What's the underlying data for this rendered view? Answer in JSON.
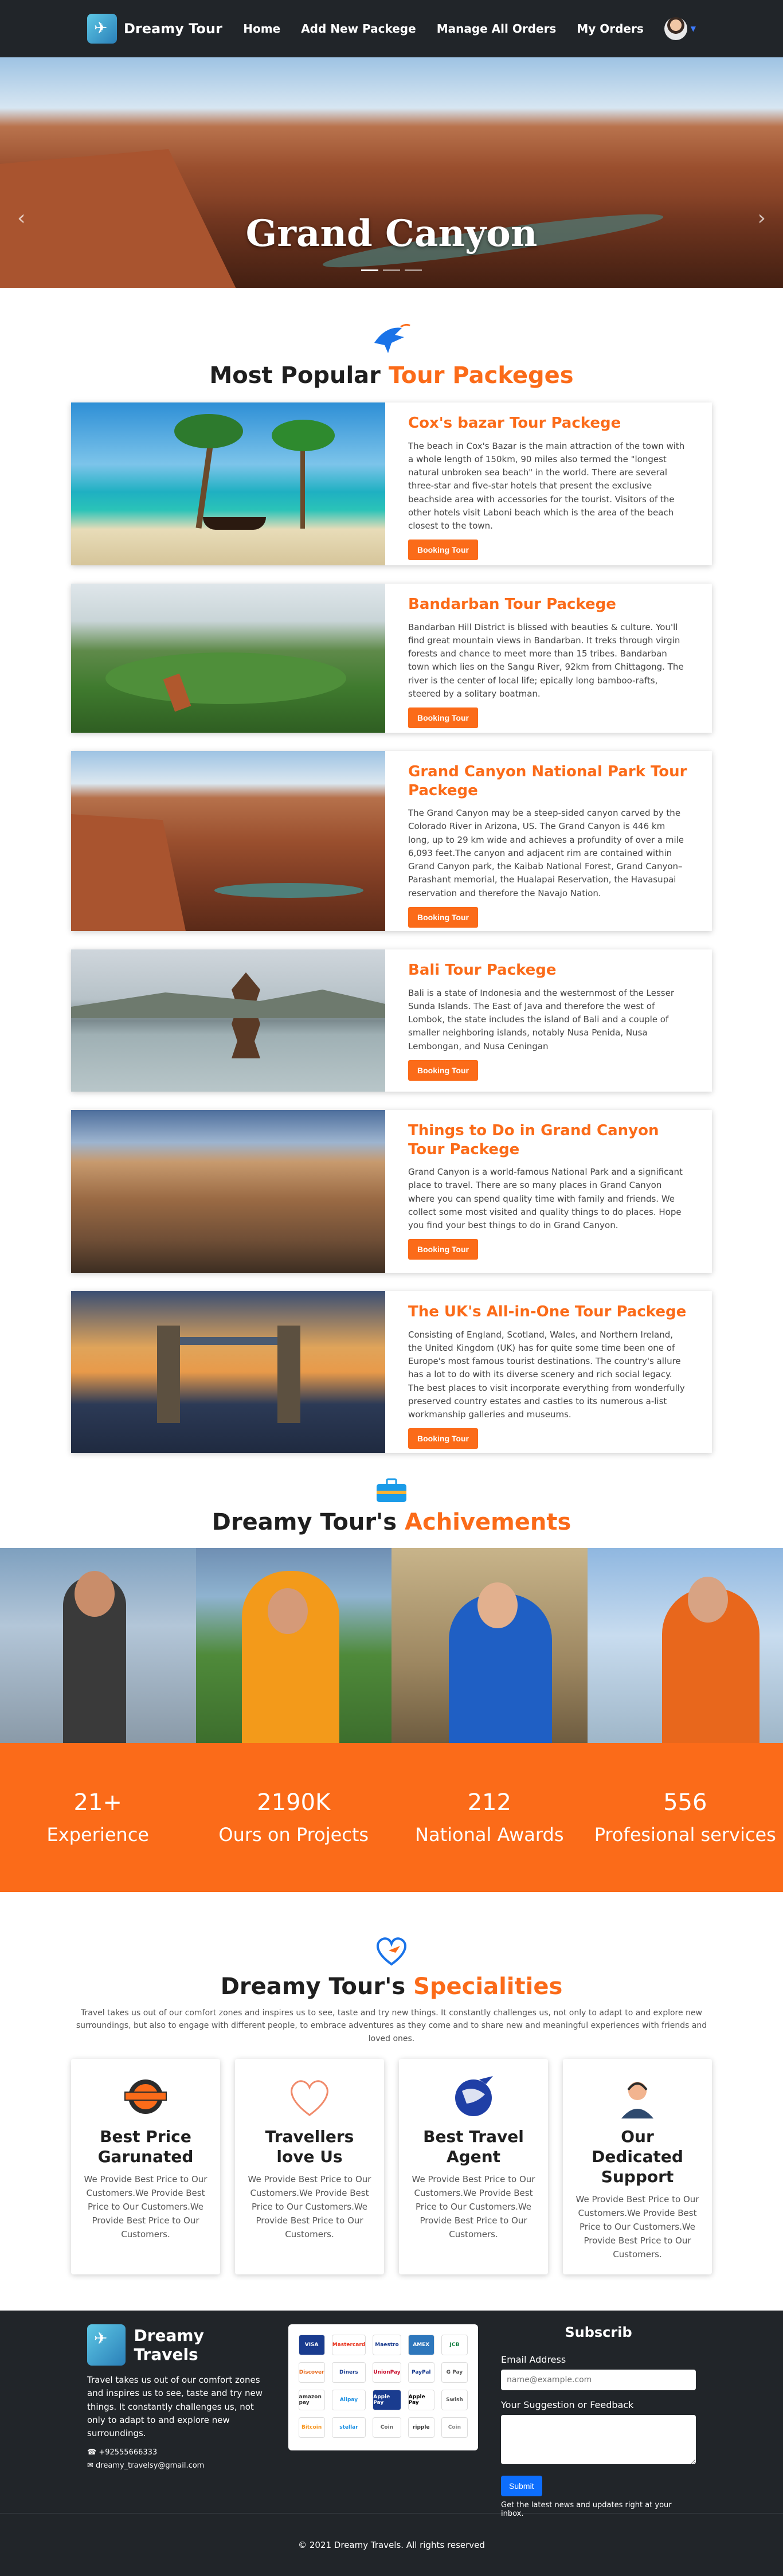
{
  "nav": {
    "brand": "Dreamy Tour",
    "links": [
      "Home",
      "Add New Packege",
      "Manage All Orders",
      "My Orders"
    ]
  },
  "hero": {
    "title": "Grand Canyon"
  },
  "tours_section": {
    "title_main": "Most Popular ",
    "title_accent": "Tour Packeges"
  },
  "tours": [
    {
      "title": "Cox's bazar Tour Packege",
      "description": "The beach in Cox's Bazar is the main attraction of the town with a whole length of 150km, 90 miles also termed the \"longest natural unbroken sea beach\" in the world. There are several three-star and five-star hotels that present the exclusive beachside area with accessories for the tourist. Visitors of the other hotels visit Laboni beach which is the area of the beach closest to the town.",
      "button": "Booking Tour"
    },
    {
      "title": "Bandarban Tour Packege",
      "description": "Bandarban Hill District is blissed with beauties & culture. You'll find great mountain views in Bandarban. It treks through virgin forests and chance to meet more than 15 tribes. Bandarban town which lies on the Sangu River, 92km from Chittagong. The river is the center of local life; epically long bamboo-rafts, steered by a solitary boatman.",
      "button": "Booking Tour"
    },
    {
      "title": "Grand Canyon National Park Tour Packege",
      "description": "The Grand Canyon may be a steep-sided canyon carved by the Colorado River in Arizona, US. The Grand Canyon is 446 km long, up to 29 km wide and achieves a profundity of over a mile 6,093 feet.The canyon and adjacent rim are contained within Grand Canyon park, the Kaibab National Forest, Grand Canyon–Parashant memorial, the Hualapai Reservation, the Havasupai reservation and therefore the Navajo Nation.",
      "button": "Booking Tour"
    },
    {
      "title": "Bali Tour Packege",
      "description": "Bali is a state of Indonesia and the westernmost of the Lesser Sunda Islands. The East of Java and therefore the west of Lombok, the state includes the island of Bali and a couple of smaller neighboring islands, notably Nusa Penida, Nusa Lembongan, and Nusa Ceningan",
      "button": "Booking Tour"
    },
    {
      "title": "Things to Do in Grand Canyon Tour Packege",
      "description": "Grand Canyon is a world-famous National Park and a significant place to travel. There are so many places in Grand Canyon where you can spend quality time with family and friends. We collect some most visited and quality things to do places. Hope you find your best things to do in Grand Canyon.",
      "button": "Booking Tour"
    },
    {
      "title": "The UK's All-in-One Tour Packege",
      "description": "Consisting of England, Scotland, Wales, and Northern Ireland, the United Kingdom (UK) has for quite some time been one of Europe's most famous tourist destinations. The country's allure has a lot to do with its diverse scenery and rich social legacy. The best places to visit incorporate everything from wonderfully preserved country estates and castles to its numerous a-list workmanship galleries and museums.",
      "button": "Booking Tour"
    }
  ],
  "achievements": {
    "title_main": "Dreamy Tour's ",
    "title_accent": "Achivements",
    "stats": [
      {
        "value": "21+",
        "label": "Experience"
      },
      {
        "value": "2190K",
        "label": "Ours on Projects"
      },
      {
        "value": "212",
        "label": "National Awards"
      },
      {
        "value": "556",
        "label": "Profesional services"
      }
    ]
  },
  "specialities": {
    "title_main": "Dreamy Tour's ",
    "title_accent": "Specialities",
    "intro": "Travel takes us out of our comfort zones and inspires us to see, taste and try new things. It constantly challenges us, not only to adapt to and explore new surroundings, but also to engage with different people, to embrace adventures as they come and to share new and meaningful experiences with friends and loved ones.",
    "cards": [
      {
        "title": "Best Price Garunated",
        "text": "We Provide Best Price to Our Customers.We Provide Best Price to Our Customers.We Provide Best Price to Our Customers."
      },
      {
        "title": "Travellers love Us",
        "text": "We Provide Best Price to Our Customers.We Provide Best Price to Our Customers.We Provide Best Price to Our Customers."
      },
      {
        "title": "Best Travel Agent",
        "text": "We Provide Best Price to Our Customers.We Provide Best Price to Our Customers.We Provide Best Price to Our Customers."
      },
      {
        "title": "Our Dedicated Support",
        "text": "We Provide Best Price to Our Customers.We Provide Best Price to Our Customers.We Provide Best Price to Our Customers."
      }
    ]
  },
  "footer": {
    "brand": "Dreamy Travels",
    "about": "Travel takes us out of our comfort zones and inspires us to see, taste and try new things. It constantly challenges us, not only to adapt to and explore new surroundings.",
    "phone": "+92555666333",
    "email": "dreamy_travelsy@gmail.com",
    "payments": [
      "VISA",
      "Mastercard",
      "Maestro",
      "AMEX",
      "JCB",
      "Discover",
      "Diners",
      "UnionPay",
      "PayPal",
      "G Pay",
      "amazon pay",
      "Alipay",
      "Apple Pay",
      "Apple Pay",
      "Swish",
      "Bitcoin",
      "stellar",
      "Coin",
      "ripple",
      "Coin"
    ],
    "subscribe_title": "Subscrib",
    "email_label": "Email Address",
    "email_placeholder": "name@example.com",
    "suggestion_label": "Your Suggestion or Feedback",
    "submit": "Submit",
    "note": "Get the latest news and updates right at your inbox.",
    "copyright": "© 2021 Dreamy Travels. All rights reserved"
  }
}
